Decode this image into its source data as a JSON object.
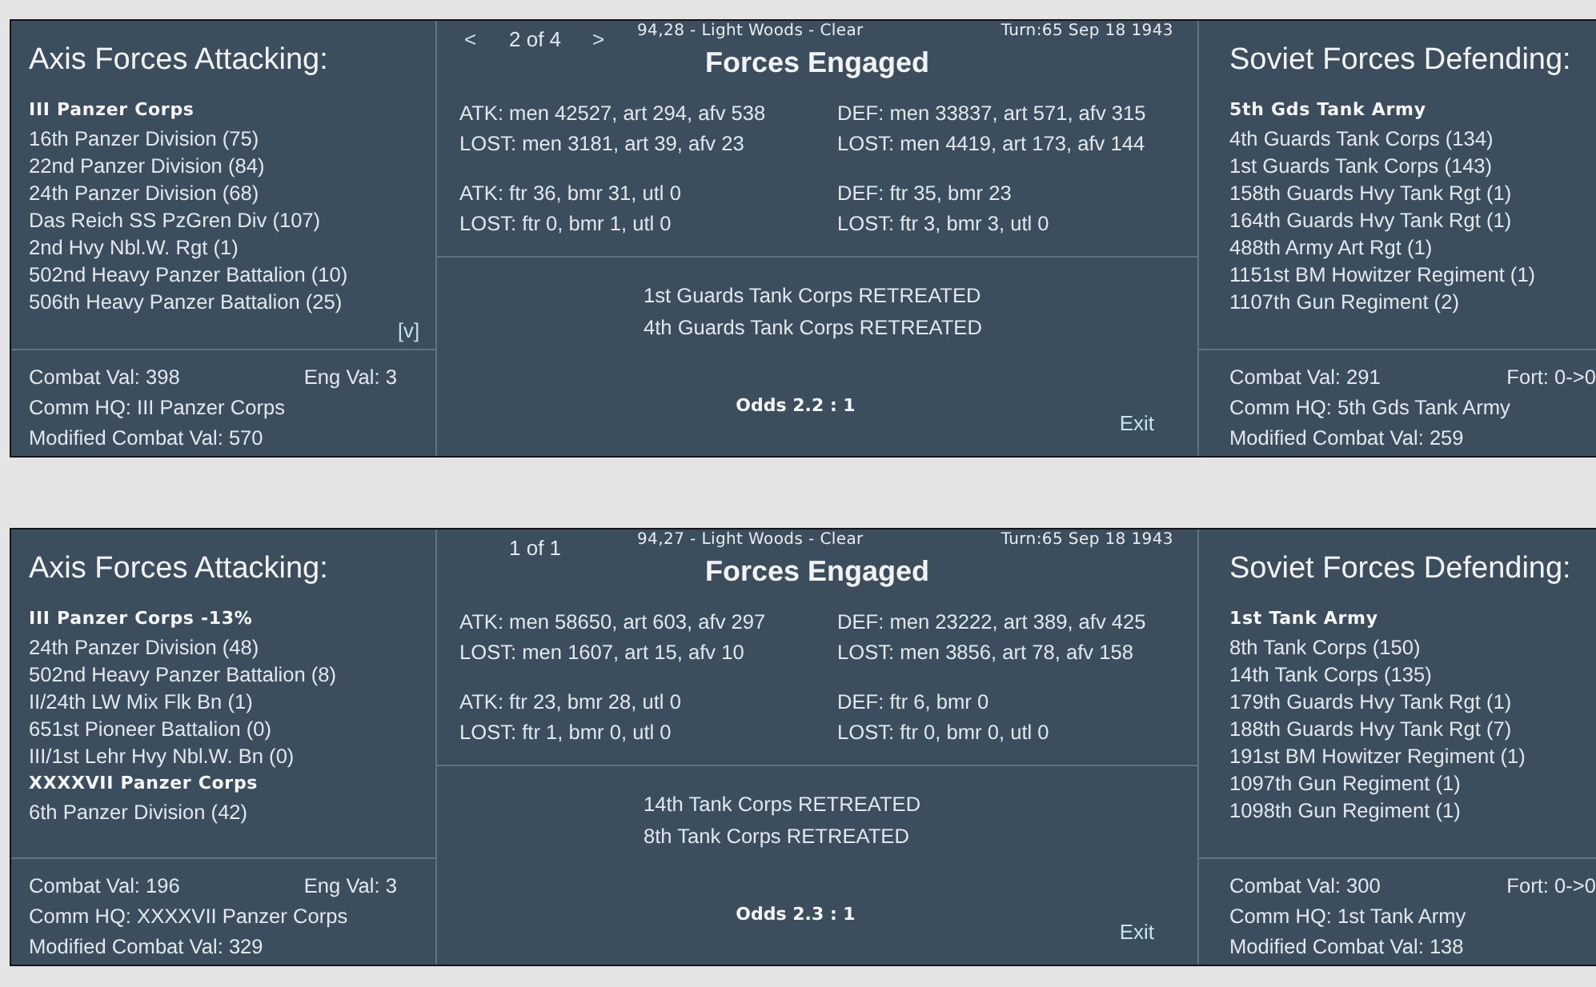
{
  "battles": [
    {
      "pager": {
        "prev": "<",
        "label": "2 of 4",
        "next": ">"
      },
      "location": "94,28 - Light Woods - Clear",
      "turn": "Turn:65 Sep 18 1943",
      "title": "Forces Engaged",
      "attacker": {
        "title": "Axis Forces Attacking:",
        "units": [
          {
            "kind": "header",
            "text": "III Panzer Corps"
          },
          {
            "kind": "unit",
            "text": "16th Panzer Division (75)"
          },
          {
            "kind": "unit",
            "text": "22nd Panzer Division (84)"
          },
          {
            "kind": "unit",
            "text": "24th Panzer Division (68)"
          },
          {
            "kind": "unit",
            "text": "Das Reich SS PzGren Div (107)"
          },
          {
            "kind": "unit",
            "text": "2nd Hvy Nbl.W. Rgt (1)"
          },
          {
            "kind": "unit",
            "text": "502nd Heavy Panzer Battalion (10)"
          },
          {
            "kind": "unit",
            "text": "506th Heavy Panzer Battalion (25)"
          }
        ],
        "more": "[v]",
        "combat_val": "Combat Val: 398",
        "eng_val": "Eng Val: 3",
        "comm_hq": "Comm HQ: III Panzer Corps",
        "modified": "Modified Combat Val: 570"
      },
      "stat_groups": [
        [
          [
            "ATK: men 42527, art 294, afv 538",
            "DEF: men 33837, art 571, afv 315"
          ],
          [
            "LOST: men 3181, art 39, afv 23",
            "LOST: men 4419, art 173, afv 144"
          ]
        ],
        [
          [
            "ATK: ftr 36, bmr 31, utl 0",
            "DEF: ftr 35, bmr 23"
          ],
          [
            "LOST: ftr 0, bmr 1, utl 0",
            "LOST: ftr 3, bmr 3, utl 0"
          ]
        ]
      ],
      "results": [
        "1st Guards Tank Corps RETREATED",
        "4th Guards Tank Corps RETREATED"
      ],
      "odds": "Odds 2.2 : 1",
      "exit": "Exit",
      "defender": {
        "title": "Soviet Forces Defending:",
        "units": [
          {
            "kind": "header",
            "text": "5th Gds Tank Army"
          },
          {
            "kind": "unit",
            "text": "4th Guards Tank Corps (134)"
          },
          {
            "kind": "unit",
            "text": "1st Guards Tank Corps (143)"
          },
          {
            "kind": "unit",
            "text": "158th Guards Hvy Tank Rgt (1)"
          },
          {
            "kind": "unit",
            "text": "164th Guards Hvy Tank Rgt (1)"
          },
          {
            "kind": "unit",
            "text": "488th Army Art Rgt (1)"
          },
          {
            "kind": "unit",
            "text": "1151st BM Howitzer Regiment (1)"
          },
          {
            "kind": "unit",
            "text": "1107th Gun Regiment (2)"
          }
        ],
        "combat_val": "Combat Val: 291",
        "fort": "Fort: 0->0",
        "comm_hq": "Comm HQ: 5th Gds Tank Army",
        "modified": "Modified Combat Val: 259"
      }
    },
    {
      "pager": {
        "label": "1 of 1"
      },
      "location": "94,27 - Light Woods - Clear",
      "turn": "Turn:65 Sep 18 1943",
      "title": "Forces Engaged",
      "attacker": {
        "title": "Axis Forces Attacking:",
        "units": [
          {
            "kind": "header",
            "text": "III Panzer Corps -13%"
          },
          {
            "kind": "unit",
            "text": "24th Panzer Division (48)"
          },
          {
            "kind": "unit",
            "text": "502nd Heavy Panzer Battalion (8)"
          },
          {
            "kind": "unit",
            "text": "II/24th LW Mix Flk Bn (1)"
          },
          {
            "kind": "unit",
            "text": "651st Pioneer Battalion (0)"
          },
          {
            "kind": "unit",
            "text": "III/1st Lehr Hvy Nbl.W. Bn (0)"
          },
          {
            "kind": "header",
            "text": "XXXXVII Panzer Corps"
          },
          {
            "kind": "unit",
            "text": "6th Panzer Division (42)"
          }
        ],
        "combat_val": "Combat Val: 196",
        "eng_val": "Eng Val: 3",
        "comm_hq": "Comm HQ: XXXXVII Panzer Corps",
        "modified": "Modified Combat Val: 329"
      },
      "stat_groups": [
        [
          [
            "ATK: men 58650, art 603, afv 297",
            "DEF: men 23222, art 389, afv 425"
          ],
          [
            "LOST: men 1607, art 15, afv 10",
            "LOST: men 3856, art 78, afv 158"
          ]
        ],
        [
          [
            "ATK: ftr 23, bmr 28, utl 0",
            "DEF: ftr 6, bmr 0"
          ],
          [
            "LOST: ftr 1, bmr 0, utl 0",
            "LOST: ftr 0, bmr 0, utl 0"
          ]
        ]
      ],
      "results": [
        "14th Tank Corps RETREATED",
        "8th Tank Corps RETREATED"
      ],
      "odds": "Odds 2.3 : 1",
      "exit": "Exit",
      "defender": {
        "title": "Soviet Forces Defending:",
        "units": [
          {
            "kind": "header",
            "text": "1st Tank Army"
          },
          {
            "kind": "unit",
            "text": "8th Tank Corps (150)"
          },
          {
            "kind": "unit",
            "text": "14th Tank Corps (135)"
          },
          {
            "kind": "unit",
            "text": "179th Guards Hvy Tank Rgt (1)"
          },
          {
            "kind": "unit",
            "text": "188th Guards Hvy Tank Rgt (7)"
          },
          {
            "kind": "unit",
            "text": "191st BM Howitzer Regiment (1)"
          },
          {
            "kind": "unit",
            "text": "1097th Gun Regiment (1)"
          },
          {
            "kind": "unit",
            "text": "1098th Gun Regiment (1)"
          }
        ],
        "combat_val": "Combat Val: 300",
        "fort": "Fort: 0->0",
        "comm_hq": "Comm HQ: 1st Tank Army",
        "modified": "Modified Combat Val: 138"
      }
    }
  ]
}
